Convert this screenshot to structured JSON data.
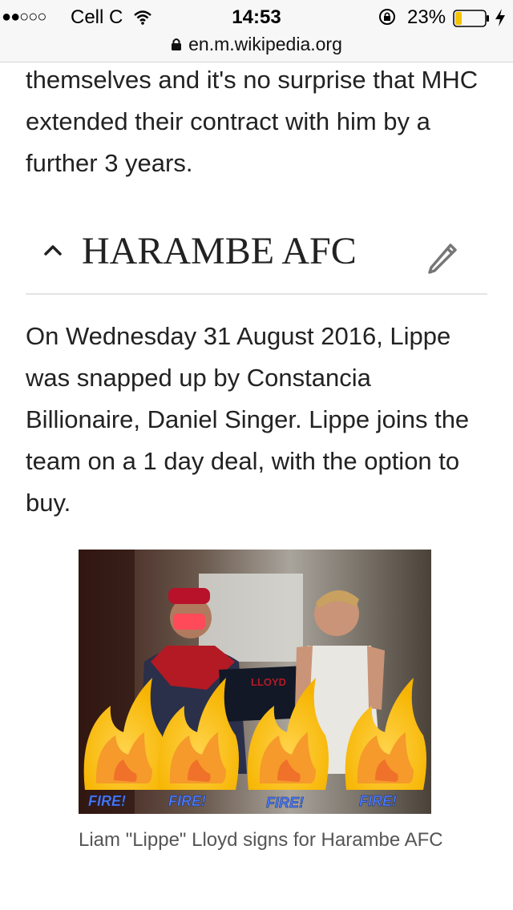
{
  "status_bar": {
    "signal": "●●○○○",
    "carrier": "Cell C",
    "time": "14:53",
    "battery_percent": "23%",
    "battery_level": 0.23,
    "battery_color": "#f5c400"
  },
  "address_bar": {
    "url": "en.m.wikipedia.org"
  },
  "article": {
    "paragraph_before": "themselves and it's no surprise that MHC extended their contract with him by a further 3 years.",
    "section_heading": "HARAMBE AFC",
    "section_paragraph": "On Wednesday 31 August 2016, Lippe was snapped up by Constancia Billionaire, Daniel Singer. Lippe joins the team on a 1 day deal, with the option to buy.",
    "figure": {
      "overlay_labels": [
        "FIRE!",
        "FIRE!",
        "FIRE!",
        "FIRE!"
      ],
      "jersey_text": "LLOYD",
      "caption": "Liam \"Lippe\" Lloyd signs for Harambe AFC"
    }
  },
  "icons": {
    "wifi": "wifi-icon",
    "rotation_lock": "rotation-lock-icon",
    "battery": "battery-icon",
    "charging": "charging-bolt-icon",
    "url_lock": "lock-icon",
    "collapse": "chevron-up-icon",
    "edit": "pencil-edit-icon"
  }
}
